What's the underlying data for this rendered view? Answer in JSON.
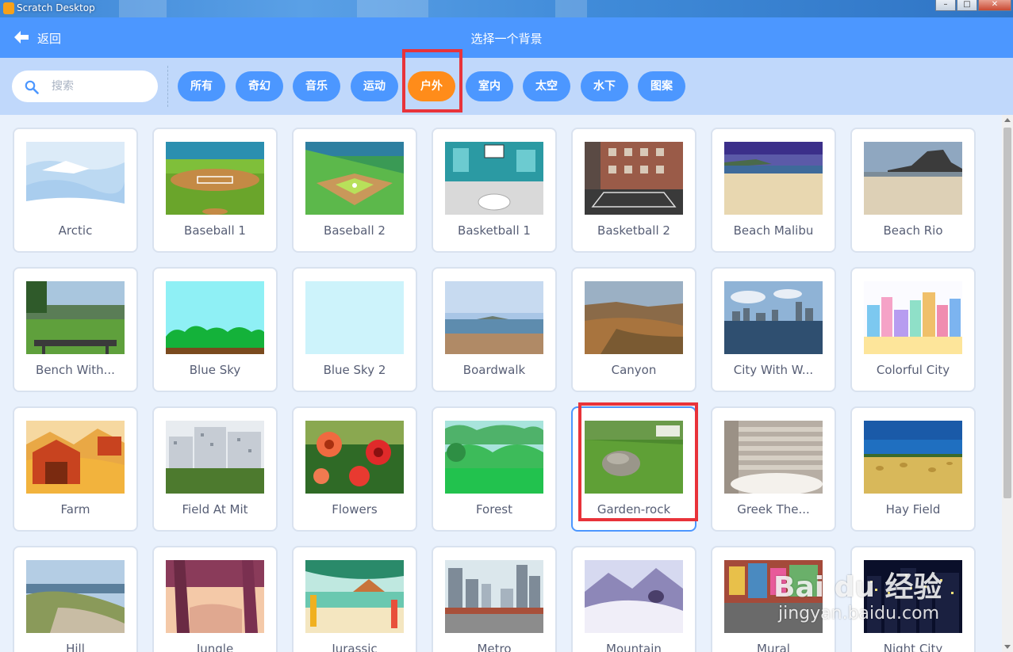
{
  "window": {
    "title": "Scratch Desktop"
  },
  "header": {
    "back_label": "返回",
    "title": "选择一个背景"
  },
  "search": {
    "placeholder": "搜索"
  },
  "tags": [
    {
      "label": "所有",
      "active": false
    },
    {
      "label": "奇幻",
      "active": false
    },
    {
      "label": "音乐",
      "active": false
    },
    {
      "label": "运动",
      "active": false
    },
    {
      "label": "户外",
      "active": true
    },
    {
      "label": "室内",
      "active": false
    },
    {
      "label": "太空",
      "active": false
    },
    {
      "label": "水下",
      "active": false
    },
    {
      "label": "图案",
      "active": false
    }
  ],
  "backdrops": [
    {
      "label": "Arctic"
    },
    {
      "label": "Baseball 1"
    },
    {
      "label": "Baseball 2"
    },
    {
      "label": "Basketball 1"
    },
    {
      "label": "Basketball 2"
    },
    {
      "label": "Beach Malibu"
    },
    {
      "label": "Beach Rio"
    },
    {
      "label": "Bench With..."
    },
    {
      "label": "Blue Sky"
    },
    {
      "label": "Blue Sky 2"
    },
    {
      "label": "Boardwalk"
    },
    {
      "label": "Canyon"
    },
    {
      "label": "City With W..."
    },
    {
      "label": "Colorful City"
    },
    {
      "label": "Farm"
    },
    {
      "label": "Field At Mit"
    },
    {
      "label": "Flowers"
    },
    {
      "label": "Forest"
    },
    {
      "label": "Garden-rock",
      "selected": true
    },
    {
      "label": "Greek The..."
    },
    {
      "label": "Hay Field"
    },
    {
      "label": "Hill"
    },
    {
      "label": "Jungle"
    },
    {
      "label": "Jurassic"
    },
    {
      "label": "Metro"
    },
    {
      "label": "Mountain"
    },
    {
      "label": "Mural"
    },
    {
      "label": "Night City"
    }
  ],
  "watermark": {
    "brand": "Bai du 经验",
    "url": "jingyan.baidu.com"
  },
  "colors": {
    "header": "#4c97ff",
    "filter_bar": "#c0d8fb",
    "active_tag": "#ff8c1a",
    "highlight": "#e8333a"
  }
}
